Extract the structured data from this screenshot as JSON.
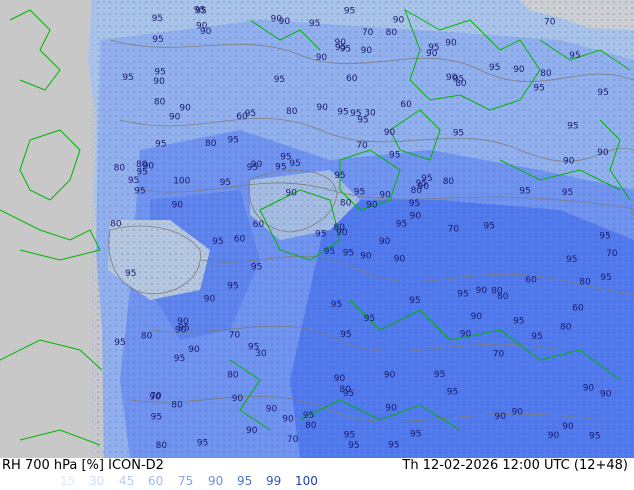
{
  "map": {
    "contour_labels": [
      "90",
      "90",
      "90",
      "70",
      "80",
      "30",
      "90",
      "30",
      "95",
      "95",
      "90",
      "95",
      "90",
      "95",
      "95",
      "95",
      "95",
      "95",
      "95",
      "90",
      "95",
      "95",
      "90",
      "95",
      "90",
      "80",
      "90",
      "95",
      "95",
      "95",
      "90",
      "80",
      "90",
      "80",
      "95",
      "95",
      "95",
      "90",
      "90",
      "80",
      "90",
      "95",
      "95",
      "90",
      "90",
      "80",
      "95",
      "80",
      "95",
      "90",
      "95",
      "95",
      "95",
      "90",
      "95",
      "80",
      "90",
      "95",
      "90",
      "80",
      "70",
      "60",
      "90",
      "95",
      "90",
      "95",
      "95",
      "90",
      "95",
      "95",
      "95",
      "90",
      "90",
      "95",
      "90",
      "95",
      "80",
      "95",
      "95",
      "90",
      "90",
      "80",
      "70",
      "60",
      "95",
      "95",
      "95",
      "90",
      "95",
      "95",
      "90",
      "70",
      "80",
      "70",
      "90",
      "80",
      "95",
      "95",
      "90",
      "80",
      "95",
      "90",
      "95",
      "95",
      "90",
      "70",
      "90",
      "95",
      "95",
      "90",
      "95",
      "90",
      "95",
      "95",
      "90",
      "80",
      "95",
      "95",
      "90",
      "95",
      "90",
      "70",
      "90",
      "80",
      "95",
      "95",
      "90",
      "80",
      "95",
      "80",
      "95",
      "95",
      "90",
      "95",
      "80",
      "95",
      "95",
      "90",
      "95",
      "95",
      "90",
      "100",
      "95",
      "90",
      "95",
      "95",
      "95",
      "90",
      "80",
      "95",
      "90",
      "60",
      "80",
      "70",
      "60",
      "80",
      "60",
      "70",
      "60",
      "60",
      "95",
      "90",
      "80",
      "95",
      "90",
      "95",
      "95",
      "90",
      "95"
    ],
    "colors": {
      "land": "#c8c8c8",
      "rh60": "#a9c4e6",
      "rh75": "#92b0ec",
      "rh90": "#6f93ee",
      "rh95": "#4f79ec",
      "coast": "#00b400",
      "contour": "#7d7d7d",
      "label": "#1a1a6e"
    }
  },
  "footer": {
    "title_left": "RH 700 hPa [%] ICON-D2",
    "title_right": "Th 12-02-2026 12:00 UTC (12+48)",
    "legend": [
      {
        "value": "15",
        "color": "#dfe9f7"
      },
      {
        "value": "30",
        "color": "#cddcf2"
      },
      {
        "value": "45",
        "color": "#b9cdee"
      },
      {
        "value": "60",
        "color": "#a2bbe8"
      },
      {
        "value": "75",
        "color": "#86a6e4"
      },
      {
        "value": "90",
        "color": "#6a8ddf"
      },
      {
        "value": "95",
        "color": "#4d74da"
      },
      {
        "value": "99",
        "color": "#3058c8"
      },
      {
        "value": "100",
        "color": "#1e3fb0"
      }
    ]
  }
}
